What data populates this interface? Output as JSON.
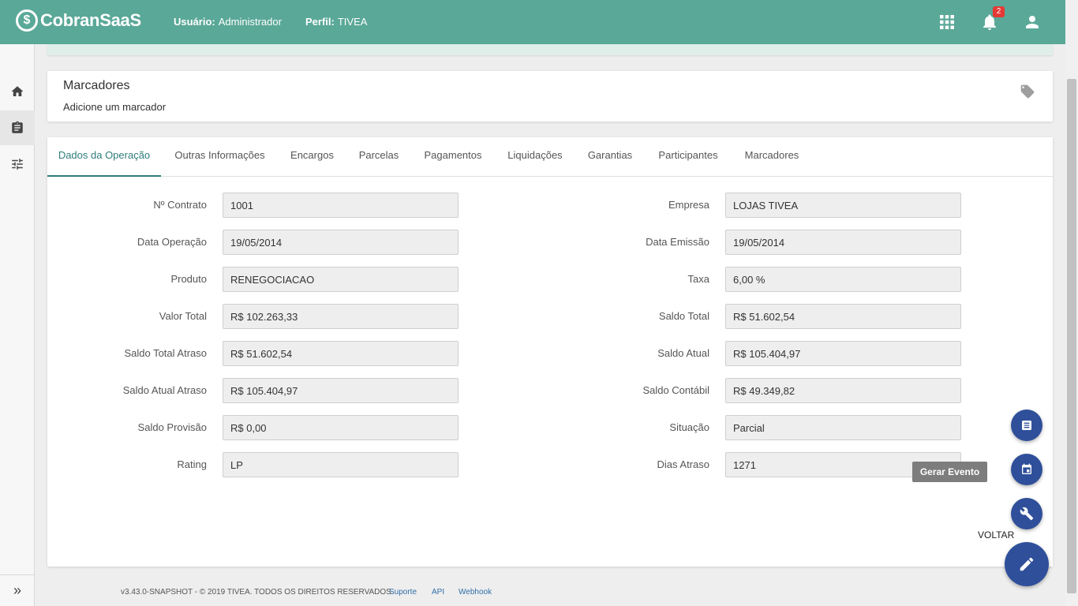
{
  "header": {
    "logo_mark": "$",
    "logo_text": "CobranSaaS",
    "user_label": "Usuário:",
    "user_value": "Administrador",
    "perfil_label": "Perfil:",
    "perfil_value": "TIVEA",
    "notification_count": "2",
    "icons": [
      "apps-icon",
      "bell-icon",
      "person-icon"
    ]
  },
  "sidebar": {
    "items": [
      {
        "name": "home",
        "icon": "home-icon"
      },
      {
        "name": "clipboard",
        "icon": "clipboard-icon"
      },
      {
        "name": "settings",
        "icon": "tune-icon"
      }
    ],
    "expand_label": "»"
  },
  "marcadores": {
    "title": "Marcadores",
    "subtitle": "Adicione um marcador",
    "icon": "tag-icon"
  },
  "tabs": [
    {
      "label": "Dados da Operação",
      "active": true
    },
    {
      "label": "Outras Informações",
      "active": false
    },
    {
      "label": "Encargos",
      "active": false
    },
    {
      "label": "Parcelas",
      "active": false
    },
    {
      "label": "Pagamentos",
      "active": false
    },
    {
      "label": "Liquidações",
      "active": false
    },
    {
      "label": "Garantias",
      "active": false
    },
    {
      "label": "Participantes",
      "active": false
    },
    {
      "label": "Marcadores",
      "active": false
    }
  ],
  "fields_left": [
    {
      "label": "Nº Contrato",
      "value": "1001"
    },
    {
      "label": "Data Operação",
      "value": "19/05/2014"
    },
    {
      "label": "Produto",
      "value": "RENEGOCIACAO"
    },
    {
      "label": "Valor Total",
      "value": "R$ 102.263,33"
    },
    {
      "label": "Saldo Total Atraso",
      "value": "R$ 51.602,54"
    },
    {
      "label": "Saldo Atual Atraso",
      "value": "R$ 105.404,97"
    },
    {
      "label": "Saldo Provisão",
      "value": "R$ 0,00"
    },
    {
      "label": "Rating",
      "value": "LP"
    }
  ],
  "fields_right": [
    {
      "label": "Empresa",
      "value": "LOJAS TIVEA"
    },
    {
      "label": "Data Emissão",
      "value": "19/05/2014"
    },
    {
      "label": "Taxa",
      "value": "6,00 %"
    },
    {
      "label": "Saldo Total",
      "value": "R$ 51.602,54"
    },
    {
      "label": "Saldo Atual",
      "value": "R$ 105.404,97"
    },
    {
      "label": "Saldo Contábil",
      "value": "R$ 49.349,82"
    },
    {
      "label": "Situação",
      "value": "Parcial"
    },
    {
      "label": "Dias Atraso",
      "value": "1271"
    }
  ],
  "fab": {
    "tooltip": "Gerar Evento",
    "voltar": "VOLTAR",
    "buttons": [
      "list-icon",
      "calendar-icon",
      "wrench-icon"
    ],
    "main_icon": "pencil-icon",
    "color": "#2f4f9a"
  },
  "footer": {
    "copyright": "v3.43.0-SNAPSHOT - © 2019 TIVEA. TODOS OS DIREITOS RESERVADOS.",
    "links": [
      "Suporte",
      "API",
      "Webhook"
    ]
  },
  "colors": {
    "header_bg": "#5aa898",
    "tab_active": "#2e7d7a"
  }
}
